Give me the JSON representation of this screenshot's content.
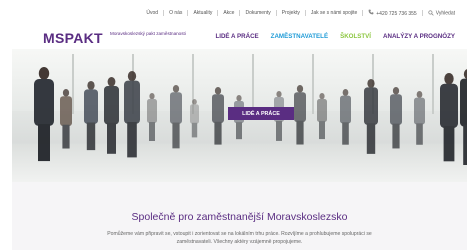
{
  "topnav": {
    "links": [
      "Úvod",
      "O nás",
      "Aktuality",
      "Akce",
      "Dokumenty",
      "Projekty",
      "Jak se s námi spojite"
    ],
    "phone": "+420 725 736 355",
    "search_label": "Vyhledat"
  },
  "header": {
    "logo": "MSPAKT",
    "logo_sub": "Moravskoslezský pakt zaměstnanosti",
    "nav": [
      {
        "label": "LIDÉ A PRÁCE",
        "color": "#5a2d82"
      },
      {
        "label": "ZAMĚSTNAVATELÉ",
        "color": "#1f9bd7"
      },
      {
        "label": "ŠKOLSTVÍ",
        "color": "#8cc63f"
      },
      {
        "label": "ANALÝZY A PROGNÓZY",
        "color": "#5a2d82"
      }
    ]
  },
  "hero": {
    "cta_label": "LIDÉ A PRÁCE"
  },
  "content": {
    "headline": "Společně pro zaměstnanější Moravskoslezsko",
    "body_line1": "Pomůžeme vám připravit se, vstoupit i zorientovat se na lokálním trhu práce. Rozvíjíme a prohlubujeme spolupráci se",
    "body_line2": "zaměstnavateli. Všechny aktéry vzájemně propojujeme."
  },
  "colors": {
    "brand_purple": "#5a2d82",
    "accent_blue": "#1f9bd7",
    "accent_green": "#8cc63f"
  }
}
